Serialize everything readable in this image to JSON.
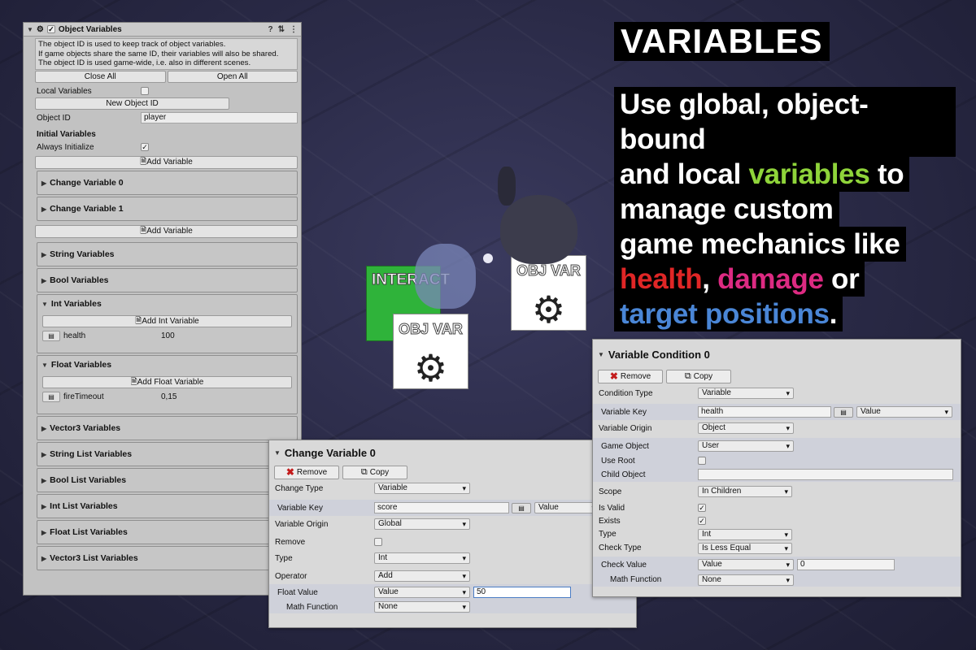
{
  "inspector": {
    "title": "Object Variables",
    "help_icon": "help-icon",
    "settings_icon": "settings-icon",
    "menu_icon": "menu-icon",
    "enabled": true,
    "info_lines": [
      "The object ID is used to keep track of object variables.",
      "If game objects share the same ID, their variables will also be shared.",
      "The object ID is used game-wide, i.e. also in different scenes."
    ],
    "close_all": "Close All",
    "open_all": "Open All",
    "local_variables_label": "Local Variables",
    "local_variables_checked": false,
    "new_object_id": "New Object ID",
    "object_id_label": "Object ID",
    "object_id_value": "player",
    "initial_variables": "Initial Variables",
    "always_initialize_label": "Always Initialize",
    "always_initialize_checked": true,
    "add_variable": "Add Variable",
    "change_sections": [
      "Change Variable 0",
      "Change Variable 1"
    ],
    "add_variable_2": "Add Variable",
    "string_variables": "String Variables",
    "bool_variables": "Bool Variables",
    "int_variables": "Int Variables",
    "add_int_variable": "Add Int Variable",
    "int_var_name": "health",
    "int_var_value": "100",
    "float_variables": "Float Variables",
    "add_float_variable": "Add Float Variable",
    "float_var_name": "fireTimeout",
    "float_var_value": "0,15",
    "vector3_variables": "Vector3 Variables",
    "string_list_variables": "String List Variables",
    "bool_list_variables": "Bool List Variables",
    "int_list_variables": "Int List Variables",
    "float_list_variables": "Float List Variables",
    "vector3_list_variables": "Vector3 List Variables"
  },
  "headline": "VARIABLES",
  "blurb": {
    "l1": "Use global, object-bound",
    "l2a": "and local ",
    "l2b": "variables",
    "l2c": " to",
    "l3": "manage custom",
    "l4": "game mechanics like",
    "l5a": "health",
    "l5b": ", ",
    "l5c": "damage",
    "l5d": " or",
    "l6a": "target positions",
    "l6b": "."
  },
  "scene": {
    "interact_text": "INTERACT",
    "objvar_text_1": "OBJ VAR",
    "objvar_text_2": "OBJ VAR"
  },
  "change_panel": {
    "title": "Change Variable 0",
    "remove": "Remove",
    "copy": "Copy",
    "change_type_label": "Change Type",
    "change_type": "Variable",
    "variable_key_label": "Variable Key",
    "variable_key": "score",
    "key_mode": "Value",
    "variable_origin_label": "Variable Origin",
    "variable_origin": "Global",
    "remove_label": "Remove",
    "remove_checked": false,
    "type_label": "Type",
    "type": "Int",
    "operator_label": "Operator",
    "operator": "Add",
    "float_value_label": "Float Value",
    "float_value_mode": "Value",
    "float_value": "50",
    "math_function_label": "Math Function",
    "math_function": "None"
  },
  "condition_panel": {
    "title": "Variable Condition 0",
    "remove": "Remove",
    "copy": "Copy",
    "condition_type_label": "Condition Type",
    "condition_type": "Variable",
    "variable_key_label": "Variable Key",
    "variable_key": "health",
    "key_mode": "Value",
    "variable_origin_label": "Variable Origin",
    "variable_origin": "Object",
    "game_object_label": "Game Object",
    "game_object": "User",
    "use_root_label": "Use Root",
    "use_root_checked": false,
    "child_object_label": "Child Object",
    "child_object": "",
    "scope_label": "Scope",
    "scope": "In Children",
    "is_valid_label": "Is Valid",
    "is_valid_checked": true,
    "exists_label": "Exists",
    "exists_checked": true,
    "type_label": "Type",
    "type": "Int",
    "check_type_label": "Check Type",
    "check_type": "Is Less Equal",
    "check_value_label": "Check Value",
    "check_value_mode": "Value",
    "check_value": "0",
    "math_function_label": "Math Function",
    "math_function": "None"
  },
  "colors": {
    "green": "#8fd43a",
    "red": "#e02626",
    "pink": "#dd2a82",
    "blue": "#4a86d6",
    "interact_green": "#2fb33a"
  }
}
